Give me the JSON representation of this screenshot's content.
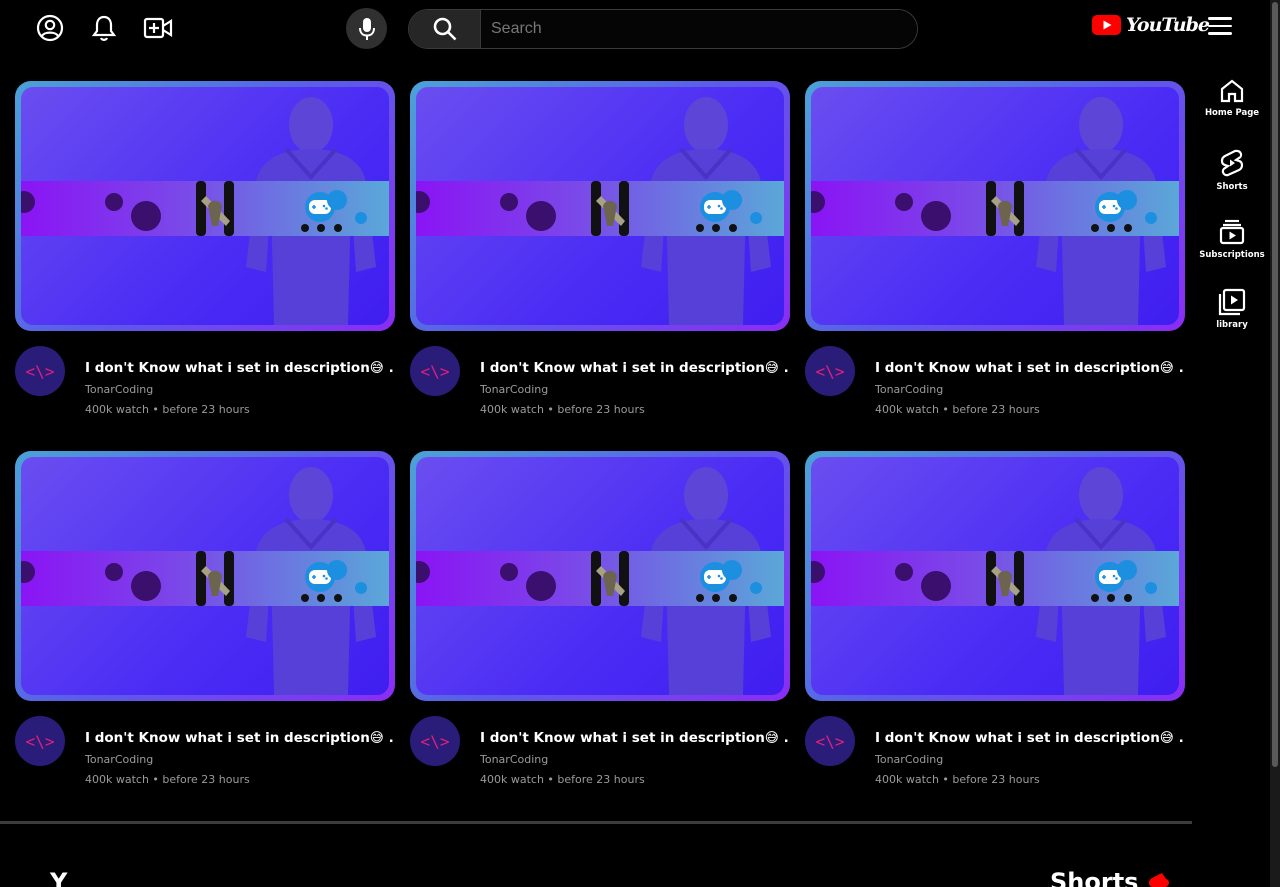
{
  "header": {
    "search_placeholder": "Search",
    "logo_text": "YouTube"
  },
  "sidebar": {
    "items": [
      {
        "label": "Home Page"
      },
      {
        "label": "Shorts"
      },
      {
        "label": "Subscriptions"
      },
      {
        "label": "library"
      }
    ]
  },
  "videos": [
    {
      "title": "I don't Know what i set in description😅 .",
      "channel": "TonarCoding",
      "stats": "400k watch • before 23 hours",
      "avatar": "<\\>"
    },
    {
      "title": "I don't Know what i set in description😅 .",
      "channel": "TonarCoding",
      "stats": "400k watch • before 23 hours",
      "avatar": "<\\>"
    },
    {
      "title": "I don't Know what i set in description😅 .",
      "channel": "TonarCoding",
      "stats": "400k watch • before 23 hours",
      "avatar": "<\\>"
    },
    {
      "title": "I don't Know what i set in description😅 .",
      "channel": "TonarCoding",
      "stats": "400k watch • before 23 hours",
      "avatar": "<\\>"
    },
    {
      "title": "I don't Know what i set in description😅 .",
      "channel": "TonarCoding",
      "stats": "400k watch • before 23 hours",
      "avatar": "<\\>"
    },
    {
      "title": "I don't Know what i set in description😅 .",
      "channel": "TonarCoding",
      "stats": "400k watch • before 23 hours",
      "avatar": "<\\>"
    }
  ],
  "sections": {
    "shorts_heading": "Shorts",
    "left_peek": "Y"
  },
  "colors": {
    "background": "#000000",
    "brand_red": "#ff0000",
    "thumb_border": "#5a5ce8",
    "avatar_bg": "#2a1d7a",
    "avatar_text": "#e0207a"
  }
}
